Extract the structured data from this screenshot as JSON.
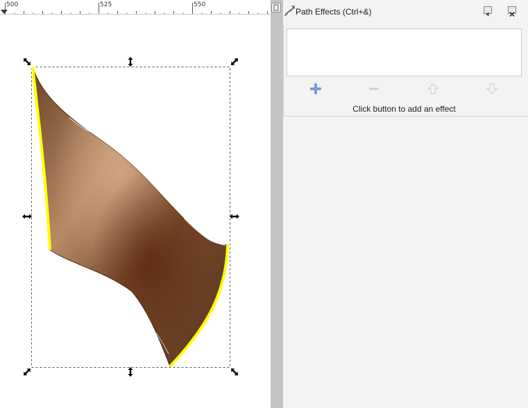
{
  "ruler": {
    "labels": [
      "500",
      "525",
      "550"
    ]
  },
  "panel": {
    "title": "Path Effects (Ctrl+&)",
    "hint": "Click button to add an effect",
    "buttons": {
      "add": "add-icon",
      "remove": "remove-icon",
      "move_up": "arrow-up-icon",
      "move_down": "arrow-down-icon"
    }
  },
  "colors": {
    "highlight_stroke": "#ffff00",
    "shape_dark": "#5e3a20",
    "shape_light": "#c49a74",
    "panel_bg": "#f3f3f3",
    "divider": "#c4c4c4",
    "add_icon": "#3a72c4"
  }
}
